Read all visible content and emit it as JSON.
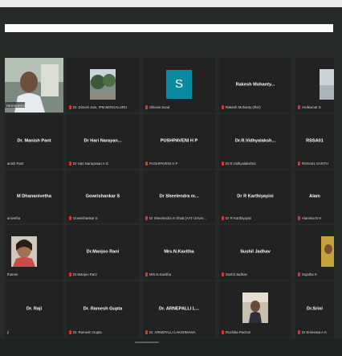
{
  "tiles": [
    {
      "name": "",
      "label": "",
      "muted": false,
      "video": "man",
      "active": true,
      "label_overlay": "RESSIDERS"
    },
    {
      "name": "",
      "label": "Dr. Dinesh Jain, IPM BENGALURU",
      "muted": true,
      "video": "trees"
    },
    {
      "name": "",
      "label": "Shivani Sood",
      "muted": true,
      "avatar": "S"
    },
    {
      "name": "Rakesh Mohanty...",
      "label": "Rakesh Mohanty (Ifter)",
      "muted": true
    },
    {
      "name": "",
      "label": "Arulkumar S",
      "muted": true,
      "video": "partial"
    },
    {
      "name": "Dr. Manish Pant",
      "label": "anish Pant",
      "muted": false
    },
    {
      "name": "Dr Hari Narayan...",
      "label": "Dr Hari Narayanan A G",
      "muted": true
    },
    {
      "name": "PUSHPAVENI H P",
      "label": "PUSHPAVENI H P",
      "muted": true
    },
    {
      "name": "Dr.R.Vidhyalaksh...",
      "label": "Dr.R.Vidhyalakshmi",
      "muted": true
    },
    {
      "name": "RSSA01",
      "label": "RSSA01 GANTH",
      "muted": true
    },
    {
      "name": "M Dhananivetha",
      "label": "anivetha",
      "muted": false
    },
    {
      "name": "Gowrishankar S",
      "label": "Gowrishankar S",
      "muted": true
    },
    {
      "name": "Dr Sheelendra m...",
      "label": "Dr Sheelendra m bhatt (AAT Univer...",
      "muted": true
    },
    {
      "name": "Dr R Karthiyayini",
      "label": "Dr R Karthiyayini",
      "muted": true
    },
    {
      "name": "Alam",
      "label": "Alamma B H",
      "muted": true
    },
    {
      "name": "",
      "label": "tharani",
      "muted": false,
      "video": "girl"
    },
    {
      "name": "Dr.Manjoo Rani",
      "label": "Dr.Manjoo Rani",
      "muted": true
    },
    {
      "name": "Mrs.N.Kavitha",
      "label": "Mrs.N.Kavitha",
      "muted": true
    },
    {
      "name": "Sushil Jadhav",
      "label": "Sushil Jadhav",
      "muted": true
    },
    {
      "name": "",
      "label": "Sujatha S",
      "muted": true,
      "video": "yellow"
    },
    {
      "name": "Dr. Raji",
      "label": "ji",
      "muted": false
    },
    {
      "name": "Dr. Ramesh Gupta",
      "label": "Dr. Ramesh Gupta",
      "muted": true
    },
    {
      "name": "Dr. ARNEPALLI L...",
      "label": "Dr. ARNEPALLI LAKSHMANA",
      "muted": true
    },
    {
      "name": "",
      "label": "Ruchika Pachori",
      "muted": true,
      "video": "woman"
    },
    {
      "name": "Dr.Srini",
      "label": "Dr.Srinivasa A K",
      "muted": true
    }
  ]
}
